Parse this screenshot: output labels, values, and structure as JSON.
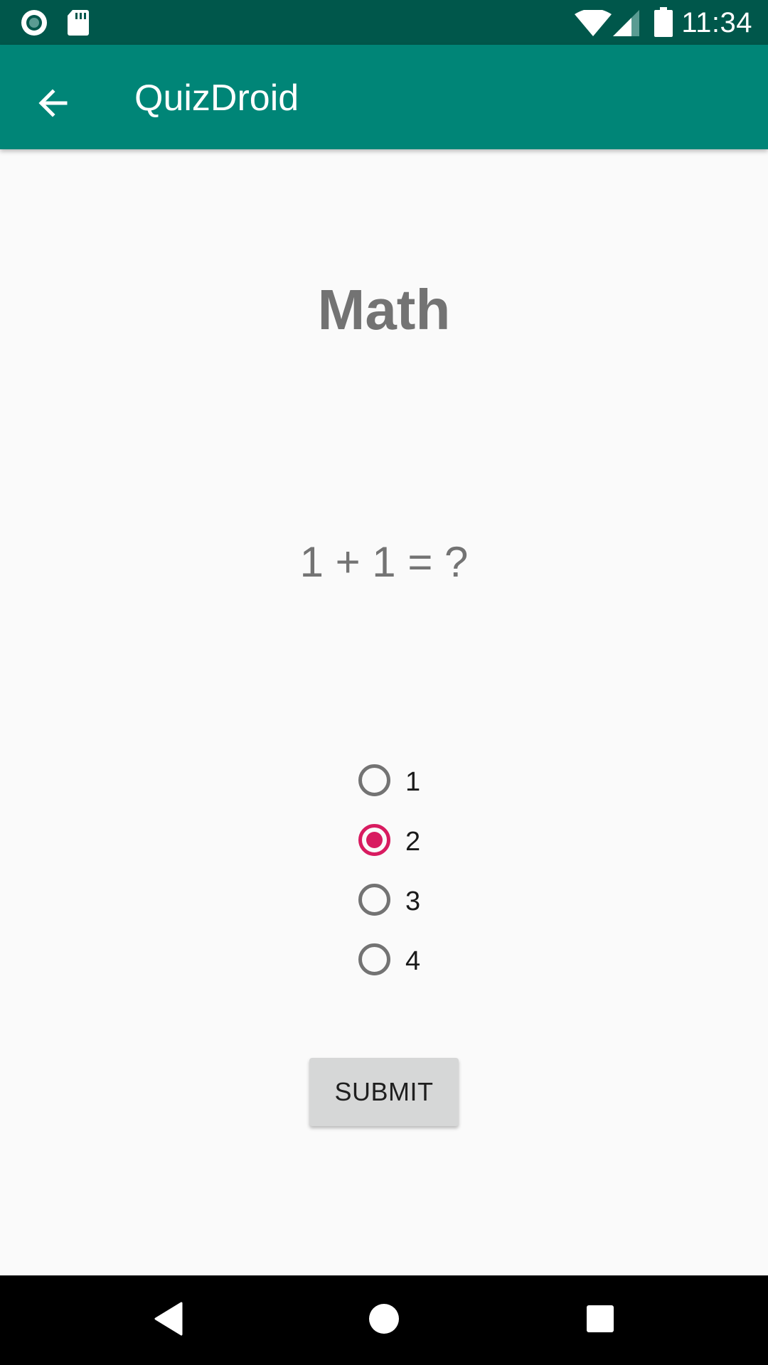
{
  "status_bar": {
    "time": "11:34",
    "icons": [
      "record-icon",
      "sd-card-icon",
      "wifi-icon",
      "cell-signal-icon",
      "battery-icon"
    ]
  },
  "app_bar": {
    "title": "QuizDroid",
    "back_icon": "arrow-back-icon"
  },
  "quiz": {
    "topic": "Math",
    "question": "1 + 1 = ?",
    "options": [
      {
        "label": "1",
        "selected": false
      },
      {
        "label": "2",
        "selected": true
      },
      {
        "label": "3",
        "selected": false
      },
      {
        "label": "4",
        "selected": false
      }
    ],
    "submit_label": "SUBMIT"
  },
  "nav_bar": {
    "icons": [
      "nav-back-icon",
      "nav-home-icon",
      "nav-recents-icon"
    ]
  },
  "colors": {
    "status_bar": "#00574b",
    "app_bar": "#008577",
    "accent": "#d81b60",
    "text_gray": "#737373",
    "button": "#d6d7d7"
  }
}
